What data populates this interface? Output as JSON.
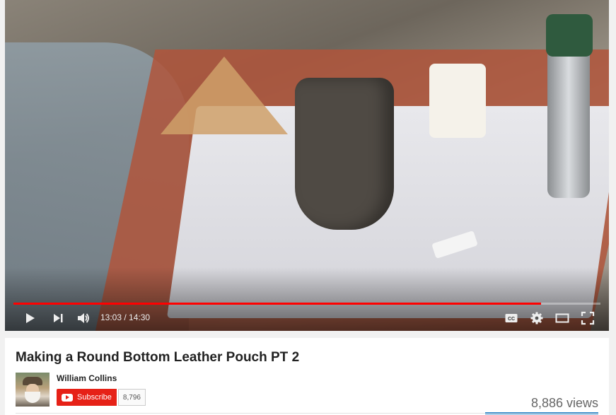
{
  "player": {
    "time_current": "13:03",
    "time_total": "14:30",
    "time_display": "13:03 / 14:30",
    "progress": 0.899,
    "accent_color": "#ff0000",
    "controls": [
      "play-icon",
      "next-icon",
      "volume-icon",
      "captions-icon",
      "settings-icon",
      "theater-icon",
      "fullscreen-icon"
    ]
  },
  "video": {
    "title": "Making a Round Bottom Leather Pouch PT 2",
    "views": "8,886 views"
  },
  "channel": {
    "name": "William Collins",
    "subscribe_label": "Subscribe",
    "subscriber_count": "8,796",
    "subscribe_color": "#e62117"
  }
}
